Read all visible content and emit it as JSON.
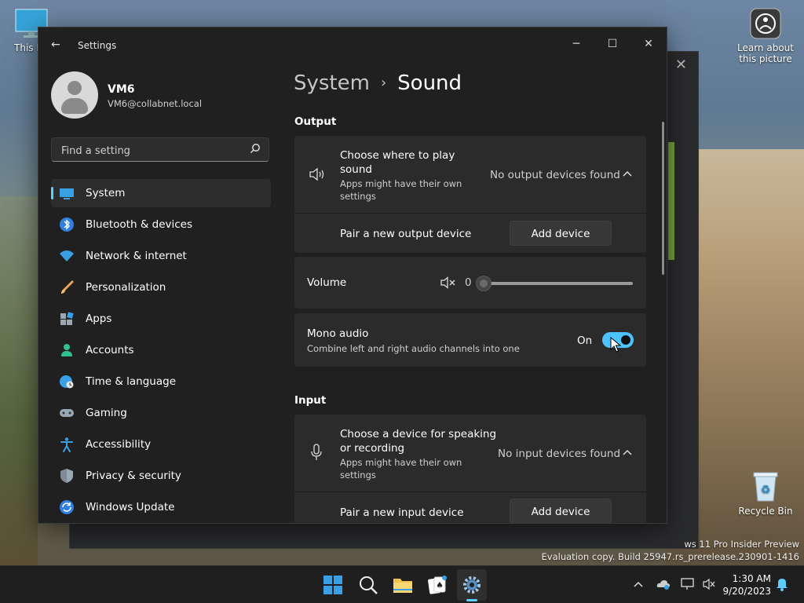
{
  "desktop": {
    "this_pc_label": "This PC",
    "learn_label_line1": "Learn about",
    "learn_label_line2": "this picture",
    "recycle_bin_label": "Recycle Bin",
    "watermark_line1": "ws 11 Pro Insider Preview",
    "watermark_line2": "Evaluation copy. Build 25947.rs_prerelease.230901-1416"
  },
  "window": {
    "title": "Settings"
  },
  "user": {
    "name": "VM6",
    "email": "VM6@collabnet.local"
  },
  "search": {
    "placeholder": "Find a setting"
  },
  "nav": {
    "items": [
      {
        "label": "System"
      },
      {
        "label": "Bluetooth & devices"
      },
      {
        "label": "Network & internet"
      },
      {
        "label": "Personalization"
      },
      {
        "label": "Apps"
      },
      {
        "label": "Accounts"
      },
      {
        "label": "Time & language"
      },
      {
        "label": "Gaming"
      },
      {
        "label": "Accessibility"
      },
      {
        "label": "Privacy & security"
      },
      {
        "label": "Windows Update"
      }
    ]
  },
  "breadcrumb": {
    "parent": "System",
    "current": "Sound"
  },
  "output": {
    "section_title": "Output",
    "choose_title_line1": "Choose where to play",
    "choose_title_line2": "sound",
    "choose_sub_line1": "Apps might have their own",
    "choose_sub_line2": "settings",
    "status": "No output devices found",
    "pair_label": "Pair a new output device",
    "add_button": "Add device",
    "volume_label": "Volume",
    "volume_value": "0",
    "mono_title": "Mono audio",
    "mono_sub": "Combine left and right audio channels into one",
    "mono_state": "On"
  },
  "input": {
    "section_title": "Input",
    "choose_title_line1": "Choose a device for speaking",
    "choose_title_line2": "or recording",
    "choose_sub_line1": "Apps might have their own",
    "choose_sub_line2": "settings",
    "status": "No input devices found",
    "pair_label": "Pair a new input device",
    "add_button": "Add device"
  },
  "taskbar": {
    "time": "1:30 AM",
    "date": "9/20/2023"
  },
  "colors": {
    "accent": "#60cdff",
    "toggle_on": "#4cc2ff",
    "window_bg": "#202020",
    "card_bg": "#2b2b2b"
  }
}
